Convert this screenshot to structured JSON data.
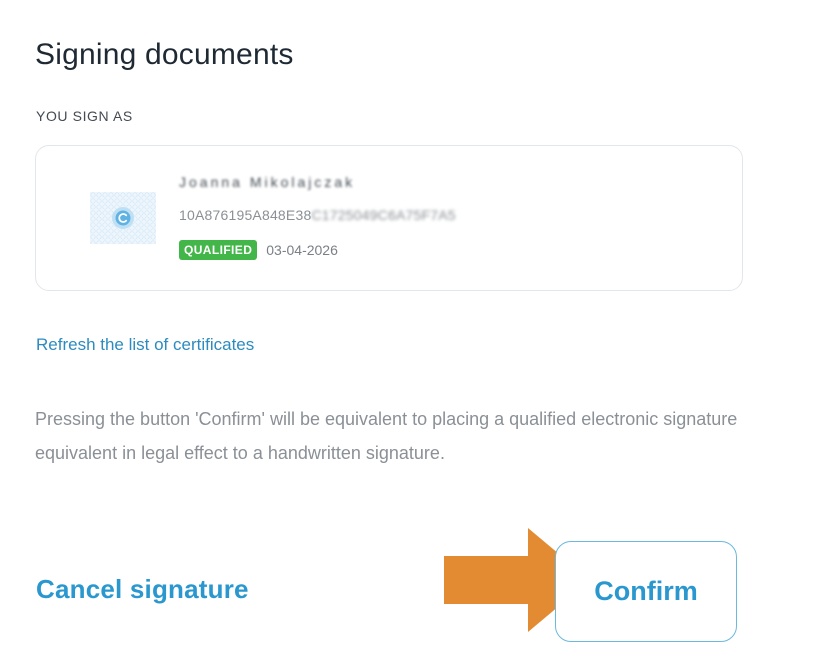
{
  "header": {
    "title": "Signing documents"
  },
  "signer": {
    "section_label": "YOU SIGN AS",
    "certificate": {
      "name": "Joanna Mikolajczak",
      "serial_visible": "10A876195A848E38",
      "serial_obscured": "C1725049C6A75F7A5",
      "badge": "QUALIFIED",
      "expiry": "03-04-2026",
      "icon": "certificate-seal-icon"
    }
  },
  "actions": {
    "refresh_label": "Refresh the list of certificates",
    "notice": "Pressing the button 'Confirm' will be equivalent to placing a qualified electronic signature equivalent in legal effect to a handwritten signature.",
    "cancel_label": "Cancel signature",
    "confirm_label": "Confirm"
  },
  "annotation": {
    "icon": "arrow-right-icon",
    "color": "#e38b33"
  },
  "colors": {
    "accent": "#2a98cf",
    "badge_green": "#43b649",
    "annotation_orange": "#e38b33"
  }
}
